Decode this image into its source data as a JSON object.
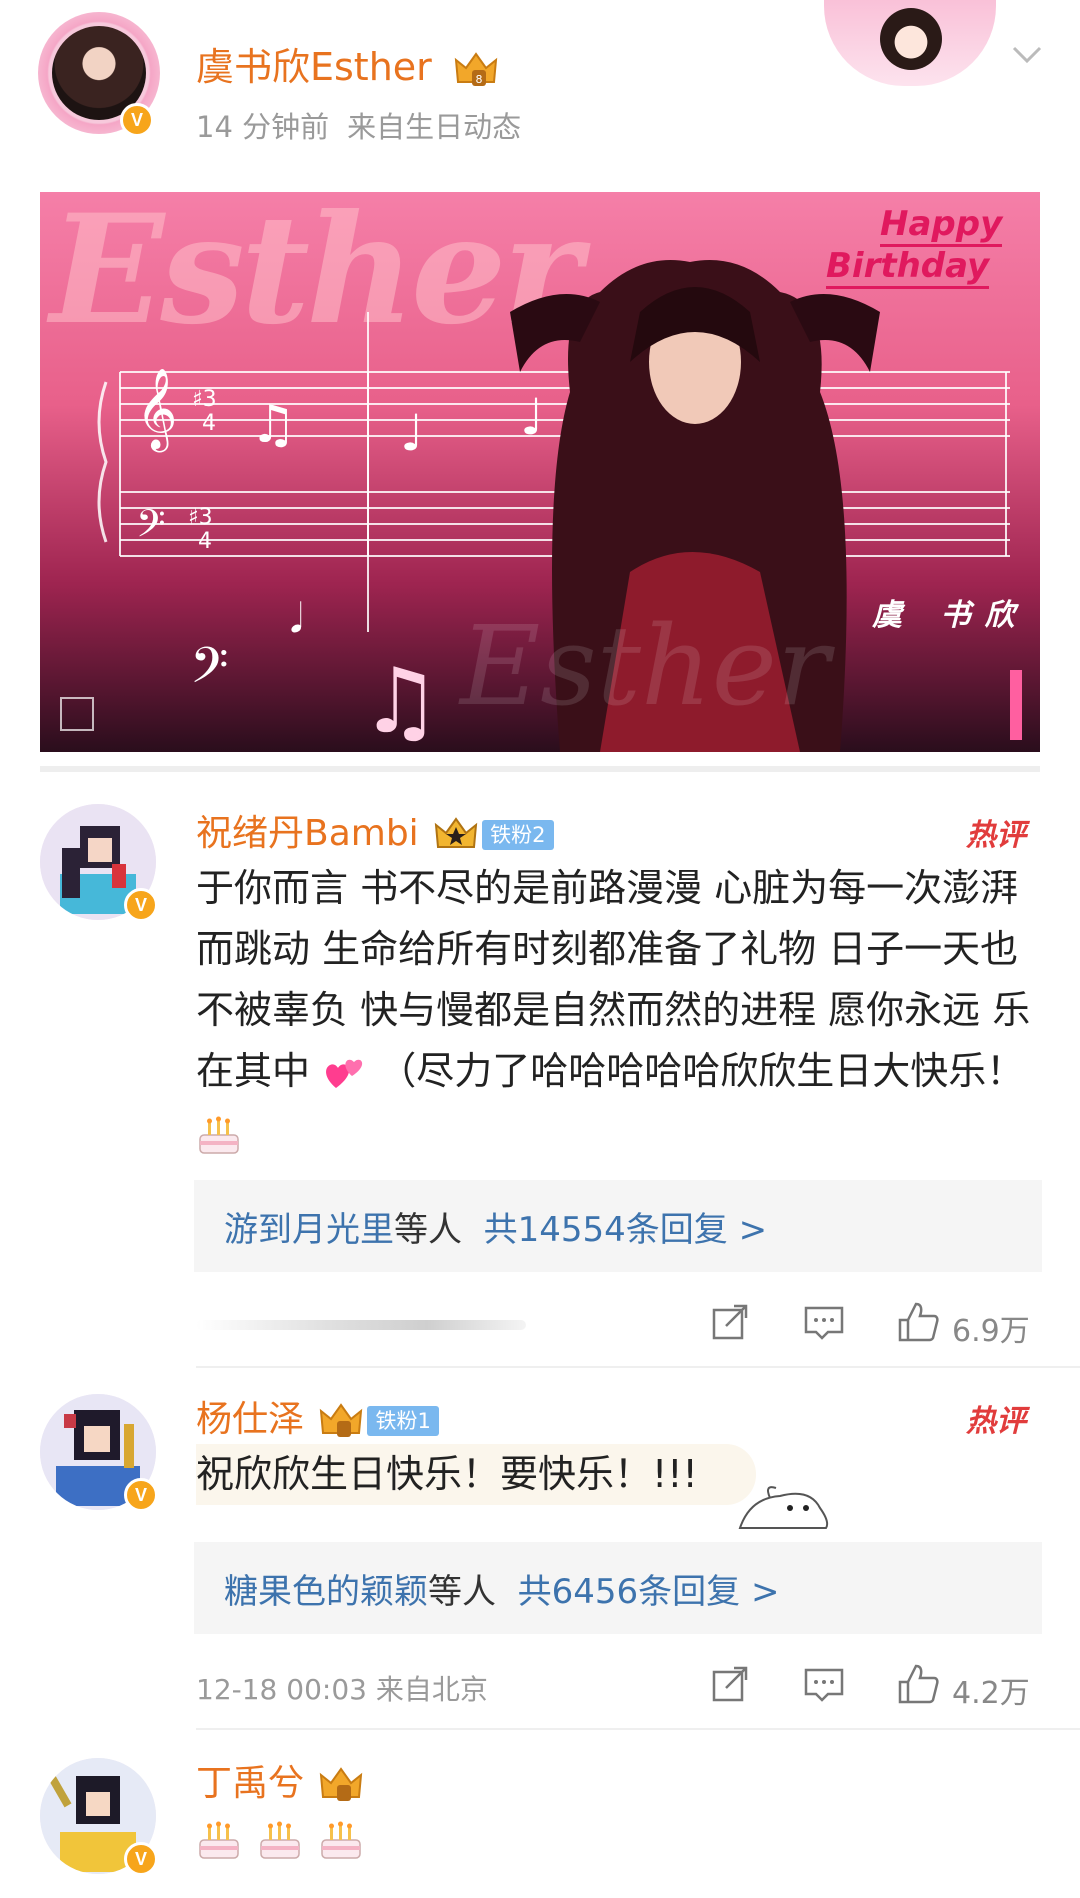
{
  "post": {
    "author": "虞书欣Esther",
    "time": "14 分钟前",
    "source": "来自生日动态",
    "banner": {
      "script_text": "Esther",
      "happy": "Happy",
      "birthday": "Birthday",
      "name": "虞 书欣"
    }
  },
  "comments": [
    {
      "name": "祝绪丹Bambi",
      "fan_badge": "铁粉2",
      "hot_label": "热评",
      "text": "于你而言 书不尽的是前路漫漫 心脏为每一次澎湃而跳动 生命给所有时刻都准备了礼物 日子一天也不被辜负 快与慢都是自然而然的进程 愿你永远 乐在其中",
      "text_tail": " （尽力了哈哈哈哈哈欣欣生日大快乐！",
      "reply_user": "游到月光里",
      "reply_plain": "等人",
      "reply_count": "共14554条回复 >",
      "time": "",
      "likes": "6.9万"
    },
    {
      "name": "杨仕泽",
      "fan_badge": "铁粉1",
      "hot_label": "热评",
      "text": "祝欣欣生日快乐！要快乐！!!!",
      "reply_user": "糖果色的颖颖",
      "reply_plain": "等人",
      "reply_count": "共6456条回复 >",
      "time": "12-18 00:03",
      "location": "来自北京",
      "likes": "4.2万"
    },
    {
      "name": "丁禹兮",
      "text": ""
    }
  ],
  "colors": {
    "accent_name": "#e8731f",
    "link": "#3d73ad",
    "hot": "#e13c3c",
    "badge": "#7ab8ef",
    "verify": "#f7a51b"
  },
  "icons": [
    "crown-icon",
    "verified-icon",
    "chevron-down-icon",
    "share-icon",
    "comment-icon",
    "like-icon",
    "birthday-cake-icon",
    "two-hearts-icon"
  ]
}
